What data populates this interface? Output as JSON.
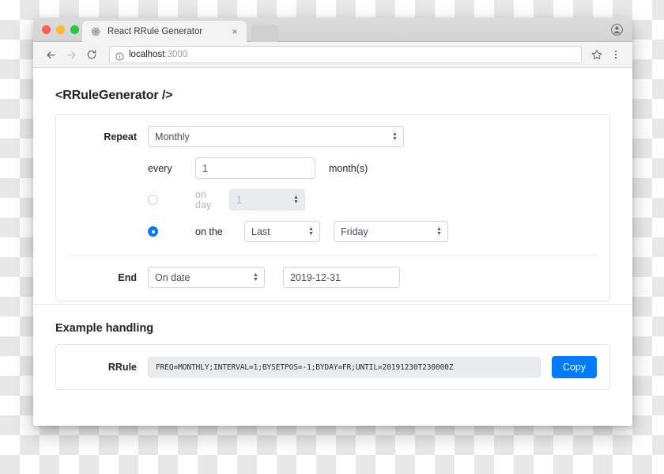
{
  "browser": {
    "tab": {
      "title": "React RRule Generator",
      "favicon": "react-atom-icon",
      "close": "×"
    },
    "toolbar": {
      "back": "←",
      "forward": "→",
      "reload": "↻",
      "url_host": "localhost",
      "url_port": ":3000",
      "info_icon": "info-circle-icon",
      "star_icon": "star-icon",
      "menu_icon": "kebab-menu-icon",
      "profile_icon": "profile-avatar-icon"
    }
  },
  "page": {
    "title": "<RRuleGenerator />",
    "generator": {
      "repeat": {
        "label": "Repeat",
        "value": "Monthly"
      },
      "interval": {
        "prefix": "every",
        "value": "1",
        "suffix": "month(s)"
      },
      "on_day": {
        "selected": false,
        "label_line1": "on",
        "label_line2": "day",
        "value": "1",
        "disabled": true
      },
      "on_the": {
        "selected": true,
        "label": "on the",
        "position": "Last",
        "weekday": "Friday"
      },
      "end": {
        "label": "End",
        "mode": "On date",
        "date": "2019-12-31"
      }
    },
    "example": {
      "title": "Example handling",
      "rrule_label": "RRule",
      "rrule_value": "FREQ=MONTHLY;INTERVAL=1;BYSETPOS=-1;BYDAY=FR;UNTIL=20191230T230000Z",
      "copy_label": "Copy"
    }
  },
  "colors": {
    "primary": "#007bff",
    "disabled_bg": "#e9ecef",
    "border": "#ced4da",
    "text": "#212529"
  }
}
